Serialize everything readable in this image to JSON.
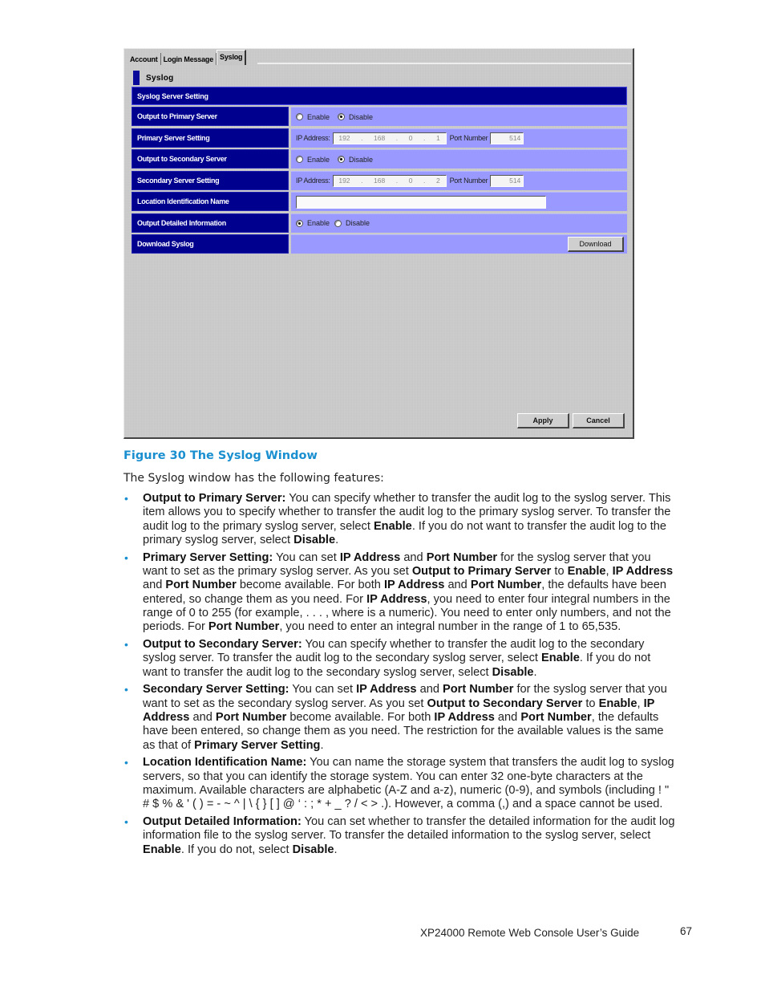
{
  "window": {
    "tabs": [
      {
        "label": "Account",
        "active": false
      },
      {
        "label": "Login Message",
        "active": false
      },
      {
        "label": "Syslog",
        "active": true
      }
    ],
    "section_title": "Syslog",
    "banner": "Syslog Server Setting",
    "rows": {
      "output_primary": {
        "label": "Output to Primary Server",
        "enable_label": "Enable",
        "disable_label": "Disable",
        "selected": "Disable"
      },
      "primary_setting": {
        "label": "Primary Server Setting",
        "ip_label": "IP Address:",
        "ip": [
          "192",
          "168",
          "0",
          "1"
        ],
        "port_label": "Port Number",
        "port": "514"
      },
      "output_secondary": {
        "label": "Output to Secondary Server",
        "enable_label": "Enable",
        "disable_label": "Disable",
        "selected": "Disable"
      },
      "secondary_setting": {
        "label": "Secondary Server Setting",
        "ip_label": "IP Address:",
        "ip": [
          "192",
          "168",
          "0",
          "2"
        ],
        "port_label": "Port Number",
        "port": "514"
      },
      "location_name": {
        "label": "Location Identification Name",
        "value": ""
      },
      "output_detailed": {
        "label": "Output Detailed Information",
        "enable_label": "Enable",
        "disable_label": "Disable",
        "selected": "Enable"
      },
      "download": {
        "label": "Download Syslog",
        "button_label": "Download"
      }
    },
    "apply_label": "Apply",
    "cancel_label": "Cancel",
    "colors": {
      "header_blue": "#00008f",
      "value_lavender": "#9999ff",
      "panel_gray": "#c6c6c6"
    }
  },
  "caption": "Figure 30 The Syslog Window",
  "intro": "The Syslog window has the following features:",
  "bullets": [
    {
      "term": "Output to Primary Server:",
      "segments": [
        {
          "t": " You can specify whether to transfer the audit log to the syslog server. This item allows you to specify whether to transfer the audit log to the primary syslog server.  To transfer the audit log to the primary syslog server, select "
        },
        {
          "b": "Enable"
        },
        {
          "t": ".  If you do not want to transfer the audit log to the primary syslog server, select "
        },
        {
          "b": "Disable"
        },
        {
          "t": "."
        }
      ]
    },
    {
      "term": "Primary Server Setting:",
      "segments": [
        {
          "t": " You can set "
        },
        {
          "b": "IP Address"
        },
        {
          "t": " and "
        },
        {
          "b": "Port Number"
        },
        {
          "t": " for the syslog server that you want to set as the primary syslog server.  As you set "
        },
        {
          "b": "Output to Primary Server"
        },
        {
          "t": " to "
        },
        {
          "b": "Enable"
        },
        {
          "t": ", "
        },
        {
          "b": "IP Address"
        },
        {
          "t": " and "
        },
        {
          "b": "Port Number"
        },
        {
          "t": " become available.  For both "
        },
        {
          "b": "IP Address"
        },
        {
          "t": " and "
        },
        {
          "b": "Port Number"
        },
        {
          "t": ", the defaults have been entered, so change them as you need.  For "
        },
        {
          "b": "IP Address"
        },
        {
          "t": ", you need to enter four integral numbers in the range of 0 to 255 (for example,       .      .      .      , where     is a numeric). You need to enter only numbers, and not the periods.  For "
        },
        {
          "b": "Port Number"
        },
        {
          "t": ", you need to enter an integral number in the range of 1 to 65,535."
        }
      ]
    },
    {
      "term": "Output to Secondary Server:",
      "segments": [
        {
          "t": " You can specify whether to transfer the audit log to the secondary syslog server.  To transfer the audit log to the secondary syslog server, select "
        },
        {
          "b": "Enable"
        },
        {
          "t": ".  If you do not want to transfer the audit log to the secondary syslog server, select "
        },
        {
          "b": "Disable"
        },
        {
          "t": "."
        }
      ]
    },
    {
      "term": "Secondary Server Setting:",
      "segments": [
        {
          "t": " You can set "
        },
        {
          "b": "IP Address"
        },
        {
          "t": " and "
        },
        {
          "b": "Port Number"
        },
        {
          "t": " for the syslog server that you want to set as the secondary syslog server.  As you set "
        },
        {
          "b": "Output to Secondary Server"
        },
        {
          "t": " to "
        },
        {
          "b": "Enable"
        },
        {
          "t": ", "
        },
        {
          "b": "IP Address"
        },
        {
          "t": " and "
        },
        {
          "b": "Port Number"
        },
        {
          "t": " become available.  For both "
        },
        {
          "b": "IP Address"
        },
        {
          "t": " and "
        },
        {
          "b": "Port Number"
        },
        {
          "t": ", the defaults have been entered, so change them as you need.  The restriction for the available values is the same as that of "
        },
        {
          "b": "Primary Server Setting"
        },
        {
          "t": "."
        }
      ]
    },
    {
      "term": "Location Identification Name:",
      "segments": [
        {
          "t": " You can name the storage system that transfers the audit log to syslog servers, so that you can identify the storage system.  You can enter 32 one-byte characters at the maximum.  Available characters are alphabetic (A-Z and a-z), numeric (0-9), and symbols (including ! \" # $ % & ' ( ) = - ~ ^ | \\ { } [ ] @ ‘ : ; * + _ ? / < > .).  However, a comma (,) and a space cannot be used."
        }
      ]
    },
    {
      "term": "Output Detailed Information:",
      "segments": [
        {
          "t": " You can set whether to transfer the detailed information for the audit log information file to the syslog server.  To transfer the detailed information to the syslog server, select "
        },
        {
          "b": "Enable"
        },
        {
          "t": ".  If you do not, select "
        },
        {
          "b": "Disable"
        },
        {
          "t": "."
        }
      ]
    }
  ],
  "footer": {
    "title": "XP24000 Remote Web Console User’s Guide",
    "page": "67"
  }
}
